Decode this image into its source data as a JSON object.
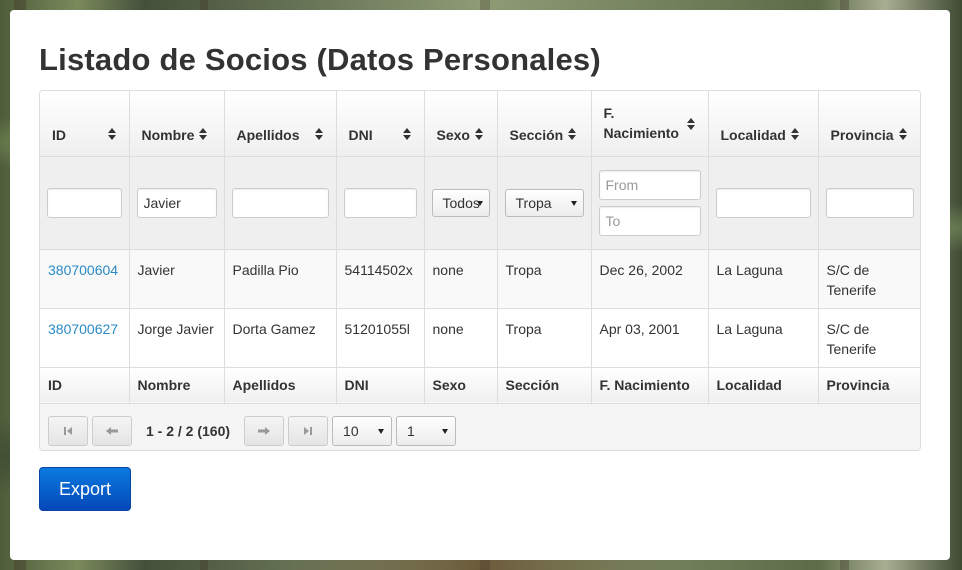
{
  "title": "Listado de Socios (Datos Personales)",
  "columns": [
    "ID",
    "Nombre",
    "Apellidos",
    "DNI",
    "Sexo",
    "Sección",
    "F. Nacimiento",
    "Localidad",
    "Provincia"
  ],
  "filters": {
    "id_value": "",
    "nombre_value": "Javier",
    "apellidos_value": "",
    "dni_value": "",
    "sexo_selected": "Todos",
    "seccion_selected": "Tropa",
    "fecha_from_placeholder": "From",
    "fecha_to_placeholder": "To",
    "localidad_value": "",
    "provincia_value": ""
  },
  "rows": [
    {
      "id": "380700604",
      "nombre": "Javier",
      "apellidos": "Padilla Pio",
      "dni": "54114502x",
      "sexo": "none",
      "seccion": "Tropa",
      "fecha": "Dec 26, 2002",
      "localidad": "La Laguna",
      "provincia": "S/C de Tenerife"
    },
    {
      "id": "380700627",
      "nombre": "Jorge Javier",
      "apellidos": "Dorta Gamez",
      "dni": "51201055l",
      "sexo": "none",
      "seccion": "Tropa",
      "fecha": "Apr 03, 2001",
      "localidad": "La Laguna",
      "provincia": "S/C de Tenerife"
    }
  ],
  "pager": {
    "info": "1 - 2 / 2 (160)",
    "page_size": "10",
    "page_number": "1",
    "icons": [
      "first-page-icon",
      "prev-page-icon",
      "next-page-icon",
      "last-page-icon"
    ]
  },
  "export_label": "Export",
  "colors": {
    "accent": "#0a6ad0",
    "link": "#2a8ac6"
  }
}
